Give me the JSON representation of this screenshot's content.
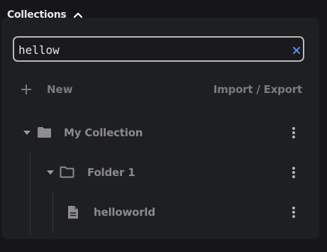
{
  "header": {
    "title": "Collections",
    "collapse_icon": "chevron-up-icon"
  },
  "search": {
    "value": "hellow",
    "clear_icon": "close-icon"
  },
  "toolbar": {
    "new_label": "New",
    "new_icon": "plus-icon",
    "import_export_label": "Import / Export"
  },
  "tree": [
    {
      "type": "collection",
      "label": "My Collection",
      "expanded": true,
      "icon": "folder-filled-icon"
    },
    {
      "type": "folder",
      "label": "Folder 1",
      "expanded": true,
      "icon": "folder-outline-icon"
    },
    {
      "type": "request",
      "label": "helloworld",
      "icon": "file-icon"
    }
  ],
  "colors": {
    "accent": "#5b8def",
    "muted_text": "#8a8a8d",
    "panel": "#1e1f21"
  }
}
